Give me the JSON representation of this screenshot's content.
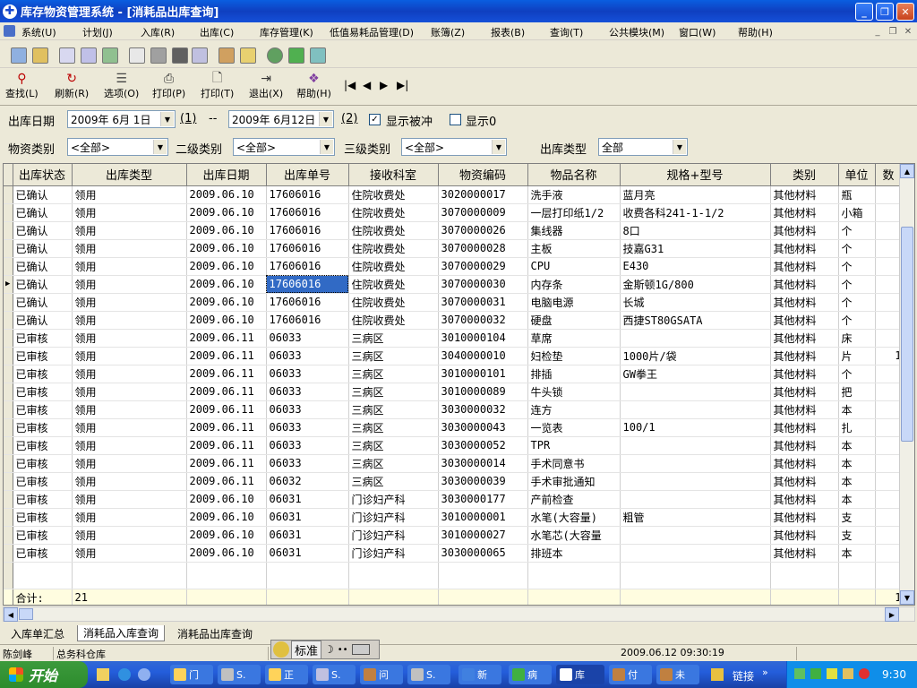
{
  "window": {
    "title": "库存物资管理系统 - [消耗品出库查询]",
    "app_icon": "plus-cross-icon"
  },
  "menu": [
    "系统(U)",
    "计划(J)",
    "入库(R)",
    "出库(C)",
    "库存管理(K)",
    "低值易耗品管理(D)",
    "账簿(Z)",
    "报表(B)",
    "查询(T)",
    "公共模块(M)",
    "窗口(W)",
    "帮助(H)"
  ],
  "toolbar2": [
    {
      "label": "查找(L)",
      "icon": "search-icon"
    },
    {
      "label": "刷新(R)",
      "icon": "refresh-icon"
    },
    {
      "label": "选项(O)",
      "icon": "options-icon"
    },
    {
      "label": "打印(P)",
      "icon": "printer-icon"
    },
    {
      "label": "打印(T)",
      "icon": "print-preview-icon"
    },
    {
      "label": "退出(X)",
      "icon": "exit-icon"
    },
    {
      "label": "帮助(H)",
      "icon": "help-book-icon"
    }
  ],
  "nav": [
    "|◀",
    "◀",
    "▶",
    "▶|"
  ],
  "filter": {
    "date_label": "出库日期",
    "date_from": "2009年 6月 1日",
    "btn1": "(1)",
    "sep": "--",
    "date_to": "2009年 6月12日",
    "btn2": "(2)",
    "chk_offset_label": "显示被冲",
    "chk_zero_label": "显示0",
    "cat_label": "物资类别",
    "cat_value": "<全部>",
    "cat2_label": "二级类别",
    "cat2_value": "<全部>",
    "cat3_label": "三级类别",
    "cat3_value": "<全部>",
    "type_label": "出库类型",
    "type_value": "全部"
  },
  "table": {
    "columns": [
      "出库状态",
      "出库类型",
      "出库日期",
      "出库单号",
      "接收科室",
      "物资编码",
      "物品名称",
      "规格+型号",
      "类别",
      "单位",
      "数"
    ],
    "rows": [
      [
        "已确认",
        "领用",
        "2009.06.10",
        "17606016",
        "住院收费处",
        "3020000017",
        "洗手液",
        "蓝月亮",
        "其他材料",
        "瓶",
        ""
      ],
      [
        "已确认",
        "领用",
        "2009.06.10",
        "17606016",
        "住院收费处",
        "3070000009",
        "一层打印纸1/2",
        "收费各科241-1-1/2",
        "其他材料",
        "小箱",
        ""
      ],
      [
        "已确认",
        "领用",
        "2009.06.10",
        "17606016",
        "住院收费处",
        "3070000026",
        "集线器",
        "8口",
        "其他材料",
        "个",
        ""
      ],
      [
        "已确认",
        "领用",
        "2009.06.10",
        "17606016",
        "住院收费处",
        "3070000028",
        "主板",
        "技嘉G31",
        "其他材料",
        "个",
        ""
      ],
      [
        "已确认",
        "领用",
        "2009.06.10",
        "17606016",
        "住院收费处",
        "3070000029",
        "CPU",
        "E430",
        "其他材料",
        "个",
        ""
      ],
      [
        "已确认",
        "领用",
        "2009.06.10",
        "17606016",
        "住院收费处",
        "3070000030",
        "内存条",
        "金斯顿1G/800",
        "其他材料",
        "个",
        ""
      ],
      [
        "已确认",
        "领用",
        "2009.06.10",
        "17606016",
        "住院收费处",
        "3070000031",
        "电脑电源",
        "长城",
        "其他材料",
        "个",
        ""
      ],
      [
        "已确认",
        "领用",
        "2009.06.10",
        "17606016",
        "住院收费处",
        "3070000032",
        "硬盘",
        "西捷ST80GSATA",
        "其他材料",
        "个",
        ""
      ],
      [
        "已审核",
        "领用",
        "2009.06.11",
        "06033",
        "三病区",
        "3010000104",
        "草席",
        "",
        "其他材料",
        "床",
        ""
      ],
      [
        "已审核",
        "领用",
        "2009.06.11",
        "06033",
        "三病区",
        "3040000010",
        "妇检垫",
        "1000片/袋",
        "其他材料",
        "片",
        "1"
      ],
      [
        "已审核",
        "领用",
        "2009.06.11",
        "06033",
        "三病区",
        "3010000101",
        "排插",
        "GW拳王",
        "其他材料",
        "个",
        ""
      ],
      [
        "已审核",
        "领用",
        "2009.06.11",
        "06033",
        "三病区",
        "3010000089",
        "牛头锁",
        "",
        "其他材料",
        "把",
        ""
      ],
      [
        "已审核",
        "领用",
        "2009.06.11",
        "06033",
        "三病区",
        "3030000032",
        "连方",
        "",
        "其他材料",
        "本",
        ""
      ],
      [
        "已审核",
        "领用",
        "2009.06.11",
        "06033",
        "三病区",
        "3030000043",
        "一览表",
        "100/1",
        "其他材料",
        "扎",
        ""
      ],
      [
        "已审核",
        "领用",
        "2009.06.11",
        "06033",
        "三病区",
        "3030000052",
        "TPR",
        "",
        "其他材料",
        "本",
        ""
      ],
      [
        "已审核",
        "领用",
        "2009.06.11",
        "06033",
        "三病区",
        "3030000014",
        "手术同意书",
        "",
        "其他材料",
        "本",
        ""
      ],
      [
        "已审核",
        "领用",
        "2009.06.11",
        "06032",
        "三病区",
        "3030000039",
        "手术审批通知",
        "",
        "其他材料",
        "本",
        ""
      ],
      [
        "已审核",
        "领用",
        "2009.06.10",
        "06031",
        "门诊妇产科",
        "3030000177",
        "产前检查",
        "",
        "其他材料",
        "本",
        ""
      ],
      [
        "已审核",
        "领用",
        "2009.06.10",
        "06031",
        "门诊妇产科",
        "3010000001",
        "水笔(大容量)",
        "粗管",
        "其他材料",
        "支",
        ""
      ],
      [
        "已审核",
        "领用",
        "2009.06.10",
        "06031",
        "门诊妇产科",
        "3010000027",
        "水笔芯(大容量",
        "",
        "其他材料",
        "支",
        ""
      ],
      [
        "已审核",
        "领用",
        "2009.06.10",
        "06031",
        "门诊妇产科",
        "3030000065",
        "排班本",
        "",
        "其他材料",
        "本",
        ""
      ]
    ],
    "summary": {
      "label": "合计:",
      "count": "21",
      "last": "1"
    }
  },
  "tabs": [
    "入库单汇总",
    "消耗品入库查询",
    "消耗品出库查询"
  ],
  "status": {
    "user": "陈剑峰",
    "dept": "总务科仓库",
    "datetime": "2009.06.12 09:30:19"
  },
  "ime": {
    "label": "标准"
  },
  "taskbar": {
    "start": "开始",
    "items": [
      "门",
      "S.",
      "正",
      "S.",
      "问",
      "S.",
      "新",
      "病",
      "库",
      "付",
      "未"
    ],
    "links": "链接",
    "clock": "9:30"
  },
  "colors": {
    "title_blue": "#0a5ee0",
    "selection": "#316ac5",
    "summary_bg": "#fffde0"
  }
}
